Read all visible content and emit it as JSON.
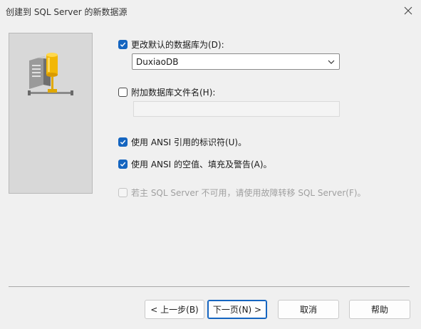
{
  "window": {
    "title": "创建到 SQL Server 的新数据源"
  },
  "options": {
    "change_default_db": {
      "label": "更改默认的数据库为(D):",
      "checked": true
    },
    "default_db_value": "DuxiaoDB",
    "attach_db_filename": {
      "label": "附加数据库文件名(H):",
      "checked": false
    },
    "attach_db_value": "",
    "ansi_quoted_identifiers": {
      "label": "使用 ANSI 引用的标识符(U)。",
      "checked": true
    },
    "ansi_nulls_paddings_warnings": {
      "label": "使用 ANSI 的空值、填充及警告(A)。",
      "checked": true
    },
    "failover": {
      "label": "若主 SQL Server 不可用，请使用故障转移 SQL Server(F)。",
      "checked": false,
      "disabled": true
    }
  },
  "buttons": {
    "back": "< 上一步(B)",
    "next": "下一页(N) >",
    "cancel": "取消",
    "help": "帮助"
  },
  "icons": {
    "close": "close-icon",
    "dropdown": "chevron-down-icon",
    "checkmark": "checkmark-icon",
    "illustration": "server-database-network-icon"
  },
  "colors": {
    "accent": "#1565c0",
    "background": "#f0f0f0"
  }
}
